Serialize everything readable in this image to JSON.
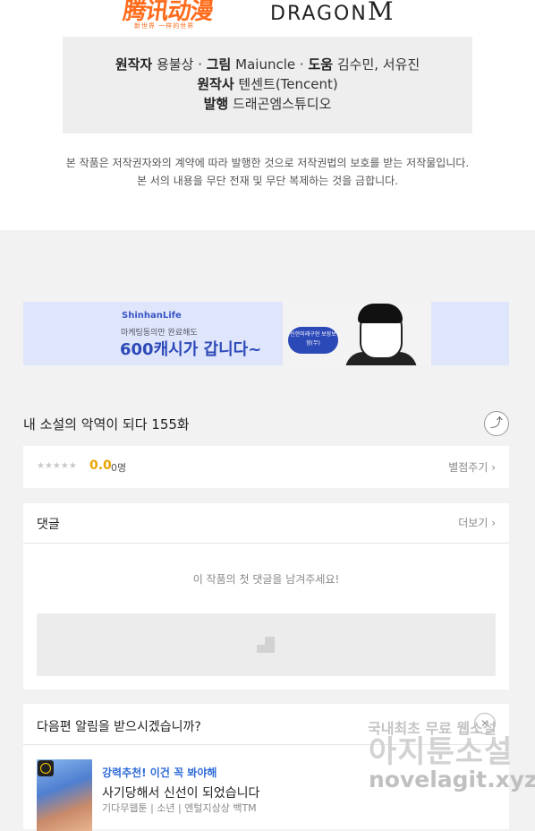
{
  "logos": {
    "left_brand": "腾讯动漫",
    "left_sub": "新世界 一样的世界",
    "right_brand": "DRAGON",
    "right_mark": "M"
  },
  "credits": {
    "line1_k1": "원작자",
    "line1_v1": "용불상",
    "line1_k2": "그림",
    "line1_v2": "Maiuncle",
    "line1_k3": "도움",
    "line1_v3": "김수민, 서유진",
    "sep": "·",
    "line2_k": "원작사",
    "line2_v": "텐센트(Tencent)",
    "line3_k": "발행",
    "line3_v": "드래곤엠스튜디오"
  },
  "copyright": {
    "line1": "본 작품은 저작권자와의 계약에 따라 발행한 것으로 저작권법의 보호를 받는 저작물입니다.",
    "line2": "본 서의 내용을 무단 전재 및 무단 복제하는 것을 금합니다."
  },
  "banner": {
    "brand": "ShinhanLife",
    "sub": "마케팅동의만 완료해도",
    "main": "600캐시가 갑니다~",
    "badge": "신한미래구현 보장보험(무)"
  },
  "episode": {
    "title": "내 소설의 악역이 되다 155화",
    "share_icon": "share-icon"
  },
  "rating": {
    "stars": "★★★★★",
    "score": "0.0",
    "count": "0명",
    "link": "별점주기 ›"
  },
  "comments": {
    "header": "댓글",
    "more": "더보기 ›",
    "empty": "이 작품의 첫 댓글을 남겨주세요!"
  },
  "notify": {
    "header": "다음편 알림을 받으시겠습니까?",
    "close": "✕",
    "tag": "강력추천! 이건 꼭 봐야해",
    "title": "사기당해서 신선이 되었습니다",
    "meta": "기다무웹툰 | 소년 | 엔털지상상 백TM"
  },
  "watermark": {
    "line1": "국내최초 무료 웹소설",
    "line2": "아지툰소설",
    "line3": "novelagit.xyz"
  }
}
